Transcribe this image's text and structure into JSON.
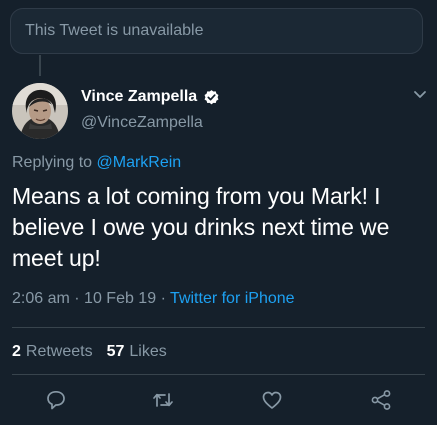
{
  "quoted": {
    "text": "This Tweet is unavailable"
  },
  "author": {
    "name": "Vince Zampella",
    "handle": "@VinceZampella"
  },
  "reply": {
    "prefix": "Replying to",
    "mention": "@MarkRein"
  },
  "tweet": {
    "text": "Means a lot coming from you Mark! I believe I owe you drinks next time we meet up!"
  },
  "meta": {
    "time": "2:06 am",
    "date": "10 Feb 19",
    "source": "Twitter for iPhone"
  },
  "stats": {
    "retweets_count": "2",
    "retweets_label": "Retweets",
    "likes_count": "57",
    "likes_label": "Likes"
  },
  "icons": {
    "verified": "verified-badge-icon",
    "menu": "chevron-down-icon",
    "reply": "reply-icon",
    "retweet": "retweet-icon",
    "like": "heart-icon",
    "share": "share-icon"
  },
  "colors": {
    "background": "#15202b",
    "accent": "#1da1f2",
    "secondary_text": "#8899a6"
  }
}
